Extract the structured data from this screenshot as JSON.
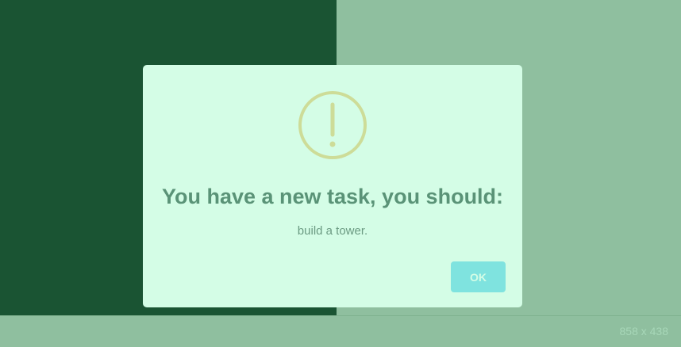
{
  "dialog": {
    "icon": "warning-circle-icon",
    "title": "You have a new task, you should:",
    "message": "build a tower.",
    "ok_label": "OK"
  },
  "overlay": {
    "size_label": "858 x 438"
  },
  "colors": {
    "left_panel": "#1a5433",
    "right_panel": "#8fbf9f",
    "dialog_bg": "#d4fde6",
    "icon": "#cddc98",
    "title": "#5a9377",
    "button": "#7fe3df"
  }
}
